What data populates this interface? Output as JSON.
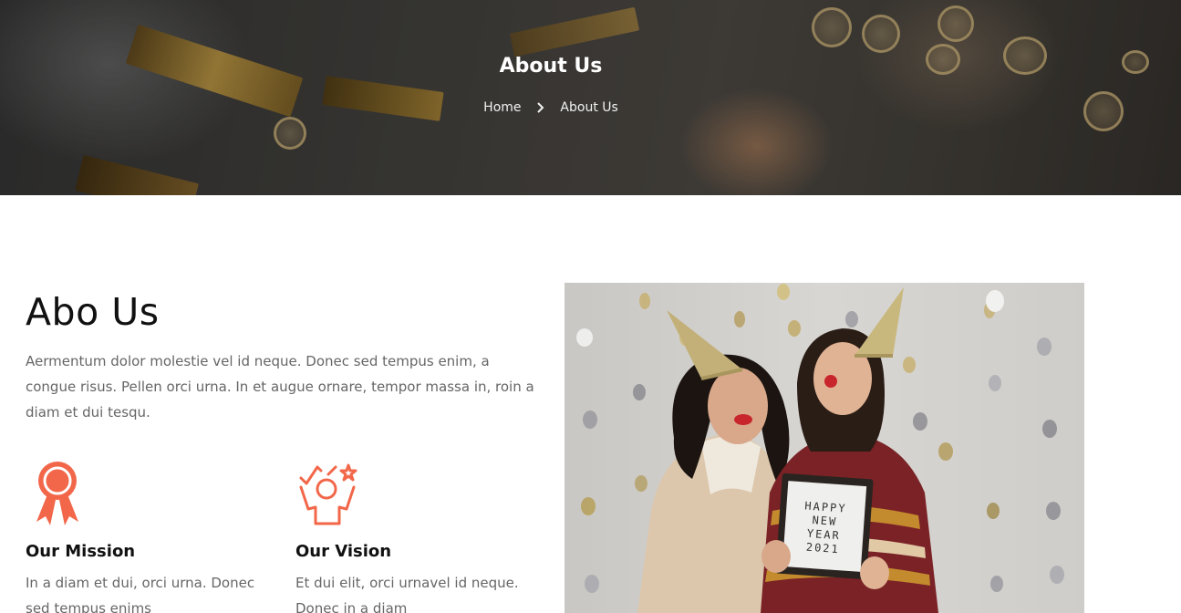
{
  "hero": {
    "title": "About Us",
    "breadcrumb": {
      "home": "Home",
      "separator_icon": "chevron-right-icon",
      "current": "About Us"
    }
  },
  "about": {
    "heading": "Abo Us",
    "description": "Aermentum dolor molestie vel id neque. Donec sed tempus enim, a congue risus. Pellen orci urna. In et augue ornare, tempor massa in, roin a diam et dui tesqu."
  },
  "features": [
    {
      "icon": "award-ribbon-icon",
      "title": "Our Mission",
      "text": "In a diam et dui, orci urna. Donec sed tempus enims"
    },
    {
      "icon": "celebrating-person-icon",
      "title": "Our Vision",
      "text": "Et dui elit, orci urnavel id neque. Donec in a diam"
    }
  ],
  "photo": {
    "sign_text": "HAPPY NEW YEAR 2021"
  },
  "colors": {
    "accent": "#f2674a",
    "heading": "#111111",
    "body_text": "#666666",
    "hero_overlay": "#3f3d3a"
  }
}
